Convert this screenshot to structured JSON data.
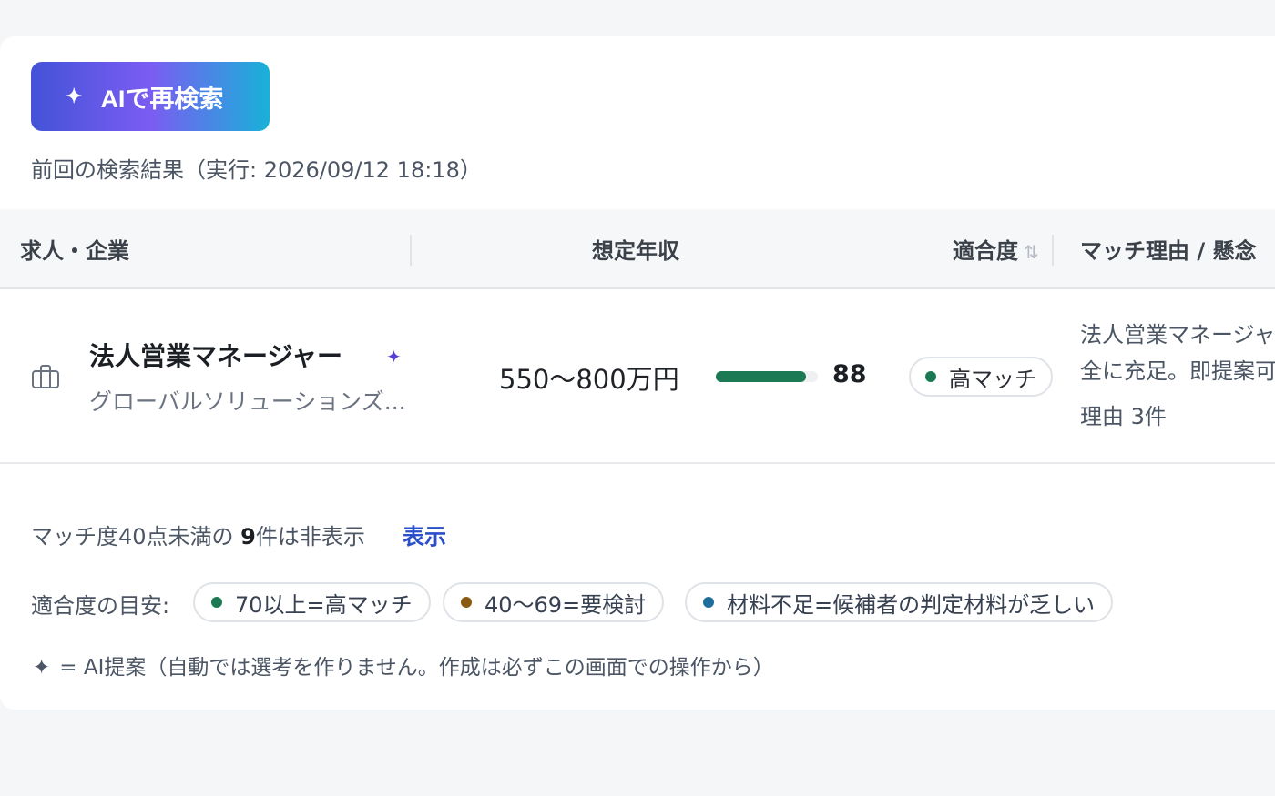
{
  "toolbar": {
    "ai_research_label": "AIで再検索",
    "spark_icon": "✦"
  },
  "previous_results": {
    "label": "前回の検索結果（実行: 2026/09/12 18:18）"
  },
  "table": {
    "headers": {
      "job_company": "求人・企業",
      "salary": "想定年収",
      "fit": "適合度",
      "fit_sort_icon": "⇅",
      "reason": "マッチ理由 / 懸念"
    },
    "rows": [
      {
        "title": "法人営業マネージャー",
        "ai_suggested": true,
        "company": "グローバルソリューションズ...",
        "salary": "550〜800万円",
        "score": 88,
        "score_fraction": 0.88,
        "fit_label": "高マッチ",
        "fit_color": "#1b7a53",
        "reason_line1": "法人営業マネージャ",
        "reason_line2": "全に充足。即提案可",
        "reason_count": "理由 3件"
      }
    ]
  },
  "hidden_note": {
    "prefix": "マッチ度40点未満の ",
    "count": "9",
    "suffix": "件は非表示",
    "show_label": "表示"
  },
  "legend": {
    "label": "適合度の目安:",
    "items": [
      {
        "text": "70以上=高マッチ",
        "color": "#1b7a53"
      },
      {
        "text": "40〜69=要検討",
        "color": "#8a5a12"
      },
      {
        "text": "材料不足=候補者の判定材料が乏しい",
        "color": "#1f6f9e"
      }
    ]
  },
  "footnote": {
    "icon": "✦",
    "text": "= AI提案（自動では選考を作りません。作成は必ずこの画面での操作から）"
  }
}
